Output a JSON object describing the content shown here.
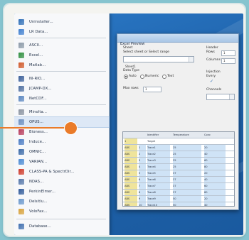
{
  "menu": {
    "items": [
      {
        "label": "Uninstaller...",
        "icon": "uninstall-icon",
        "color": "#2f6fb8"
      },
      {
        "label": "LR Data...",
        "icon": "data-icon",
        "color": "#3f7fcf"
      },
      {
        "label": "ASCII...",
        "icon": "ascii-icon",
        "color": "#8c9aa8"
      },
      {
        "label": "Excel...",
        "icon": "excel-icon",
        "color": "#2f8f3f"
      },
      {
        "label": "Matlab...",
        "icon": "matlab-icon",
        "color": "#d15a2a"
      },
      {
        "label": "NI-RIO...",
        "icon": "rio-icon",
        "color": "#3a5f9a"
      },
      {
        "label": "JCAMP-DX...",
        "icon": "jcamp-icon",
        "color": "#4f6fa0"
      },
      {
        "label": "NetCDF...",
        "icon": "netcdf-icon",
        "color": "#5a86c0"
      },
      {
        "label": "Minolta...",
        "icon": "minolta-icon",
        "color": "#8a93a0"
      },
      {
        "label": "OPUS...",
        "icon": "opus-icon",
        "color": "#6c8fbf"
      },
      {
        "label": "Bioness...",
        "icon": "bioness-icon",
        "color": "#b83a5a"
      },
      {
        "label": "Induce...",
        "icon": "induce-icon",
        "color": "#4a7cc4"
      },
      {
        "label": "OMNIC...",
        "icon": "omnic-icon",
        "color": "#3b6aa8"
      },
      {
        "label": "VARIAN...",
        "icon": "varian-icon",
        "color": "#4b8bd4"
      },
      {
        "label": "CLASS-PA & SpectrDir...",
        "icon": "classpa-icon",
        "color": "#cf3a2a"
      },
      {
        "label": "NDAS...",
        "icon": "ndas-icon",
        "color": "#5577aa"
      },
      {
        "label": "PerkinElmer...",
        "icon": "perkinelmer-icon",
        "color": "#2f5a9a"
      },
      {
        "label": "Delsitlu...",
        "icon": "delsitlu-icon",
        "color": "#6a98cc"
      },
      {
        "label": "VoloFax...",
        "icon": "volofax-icon",
        "color": "#d8a23a"
      },
      {
        "label": "Database...",
        "icon": "database-icon",
        "color": "#3f6fb0"
      }
    ]
  },
  "dialog": {
    "title": "Excel Preview",
    "sheet_label": "Sheet",
    "sheet_sub": "Select sheet or Select range",
    "sheet_value": "Sheet1",
    "header_label": "Header",
    "rows_label": "Rows",
    "rows_value": "1",
    "columns_label": "Columns",
    "columns_value": "1",
    "data_type_label": "Data Type",
    "radio_options": [
      "Auto",
      "Numeric",
      "Text"
    ],
    "max_rows_label": "Max rows",
    "max_rows_value": "1",
    "injection_label": "Injection",
    "injection_sub": "Every",
    "channels_label": "Channels"
  },
  "grid": {
    "headers": [
      "",
      "",
      "Identifier",
      "Temperature",
      "Conc"
    ],
    "rows": [
      [
        "1",
        "",
        "Target",
        "",
        ""
      ],
      [
        "ABS",
        "1",
        "Trace1",
        "25",
        "20"
      ],
      [
        "ABS",
        "2",
        "Trace2",
        "25",
        "40"
      ],
      [
        "ABS",
        "3",
        "Trace3",
        "25",
        "60"
      ],
      [
        "ABS",
        "4",
        "Trace4",
        "25",
        "80"
      ],
      [
        "ABS",
        "5",
        "Trace5",
        "37",
        "20"
      ],
      [
        "ABS",
        "6",
        "Trace6",
        "37",
        "40"
      ],
      [
        "ABS",
        "7",
        "Trace7",
        "37",
        "60"
      ],
      [
        "ABS",
        "8",
        "Trace8",
        "37",
        "80"
      ],
      [
        "ABS",
        "9",
        "Trace9",
        "50",
        "20"
      ],
      [
        "ABS",
        "10",
        "Trace10",
        "50",
        "40"
      ]
    ]
  },
  "colors": {
    "accent": "#ea7b29",
    "desktop": "#2b79c7",
    "row_header": "#efe49b",
    "cell_selected": "#cfe3f6"
  }
}
